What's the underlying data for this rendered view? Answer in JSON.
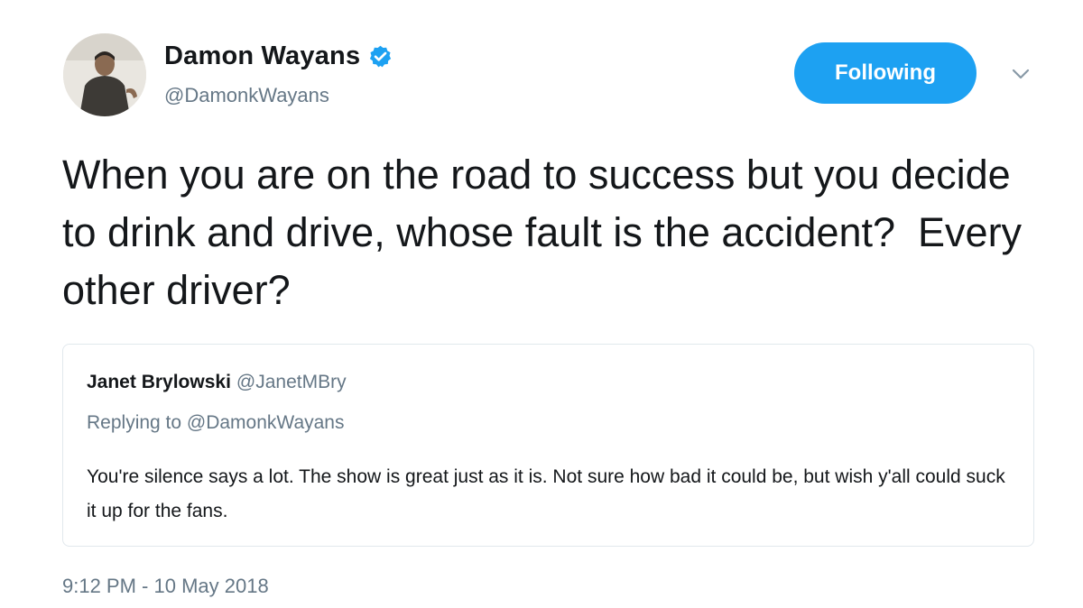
{
  "tweet": {
    "author": {
      "display_name": "Damon Wayans",
      "handle": "@DamonkWayans",
      "verified": true
    },
    "follow_button_label": "Following",
    "text": "When you are on the road to success but you decide to drink and drive, whose fault is the accident?  Every other driver?",
    "timestamp": "9:12 PM - 10 May 2018"
  },
  "quoted_tweet": {
    "author_name": "Janet Brylowski",
    "author_handle": "@JanetMBry",
    "replying_to": "Replying to @DamonkWayans",
    "text": "You're silence says a lot. The show is great just as it is. Not sure how bad it could be, but wish y'all could suck it up for the fans."
  },
  "colors": {
    "accent": "#1da1f2",
    "text_primary": "#14171a",
    "text_secondary": "#657786",
    "border": "#e1e8ed"
  },
  "icons": {
    "verified": "verified-badge-icon",
    "caret": "chevron-down-icon"
  }
}
